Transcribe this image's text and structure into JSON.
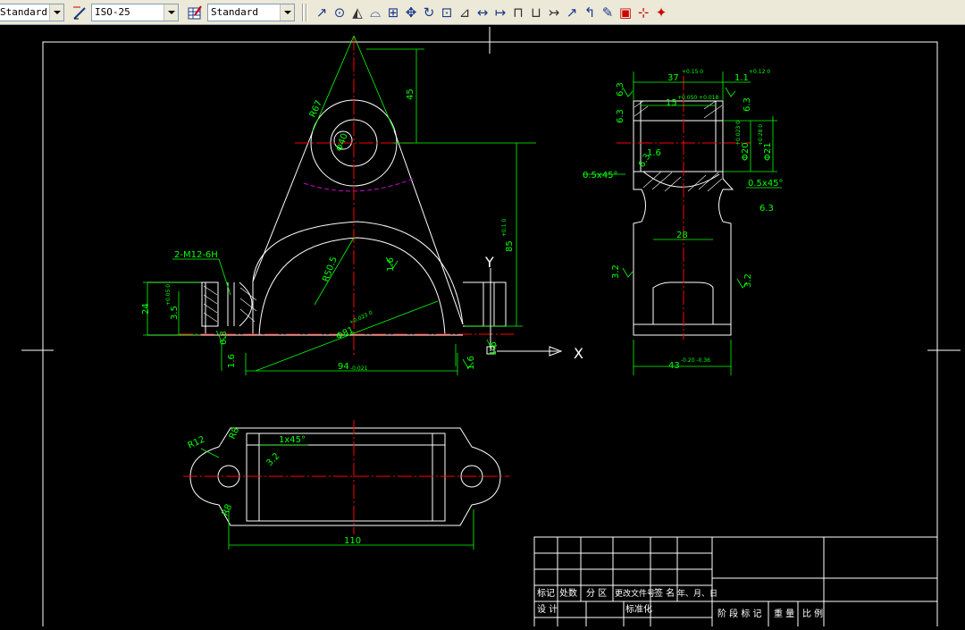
{
  "toolbar": {
    "text_style_value": "Standard",
    "dim_style_value": "ISO-25",
    "table_style_value": "Standard",
    "icons": [
      "dim-linear-icon",
      "dim-aligned-icon",
      "dim-arc-icon",
      "dim-ordinate-icon",
      "dim-radius-icon",
      "dim-jogged-icon",
      "dim-diameter-icon",
      "dim-angular-icon",
      "quick-dim-icon",
      "dim-baseline-icon",
      "dim-continue-icon",
      "dim-space-icon",
      "dim-break-icon",
      "tolerance-icon",
      "center-mark-icon",
      "inspection-icon",
      "jogged-linear-icon",
      "dim-edit-icon",
      "dim-text-edit-icon",
      "dim-update-icon"
    ]
  },
  "drawing": {
    "ucs_y": "Y",
    "ucs_x": "X",
    "dims": {
      "r67": "R67",
      "d40": "Φ40",
      "d45": "45",
      "d85": "85",
      "d85_tol": "+0.1  0",
      "r50": "R50.5",
      "d81": "Φ81",
      "d81_tol": "+0.023  0",
      "thread": "2-M12-6H",
      "d24": "24",
      "d35": "3.5",
      "d35_tol": "+0.05  0",
      "d94": "94",
      "d94_tol": "-0.021",
      "r16a": "1.6",
      "r63a": "6.3",
      "r16b": "1.6",
      "r16c": "1.6",
      "r16d": "1.6",
      "r16e": "1.6",
      "d37": "37",
      "d37_tol": "+0.15  0",
      "d11": "1.1",
      "d11_tol": "+0.12  0",
      "d15": "15",
      "d15_tol": "+0.050  +0.018",
      "d20": "Φ20",
      "d20_tol": "+0.023  0",
      "d21": "Φ21",
      "d21_tol": "+0.28  0",
      "r63b": "6.3",
      "r63c": "6.3",
      "r63d": "6.3",
      "r16f": "1.6",
      "r63e": "6.3",
      "ch1": "0.5x45°",
      "ch2": "0.5x45°",
      "r63f": "6.3",
      "d28": "28",
      "r32a": "3.2",
      "r32b": "3.2",
      "d43": "43",
      "d43_tol": "-0.20  -0.36",
      "r12": "R12",
      "r8a": "R8",
      "r8b": "R8",
      "ch3": "1x45°",
      "r32c": "3.2",
      "d110": "110"
    },
    "title_block": {
      "biaoji": "标记",
      "chushu": "处数",
      "fenqu": "分 区",
      "genggai": "更改文件号",
      "qianming": "签 名",
      "riqi": "年、月、日",
      "sheji": "设 计",
      "biaozhunhua": "标准化",
      "jieduan": "阶 段 标 记",
      "zhongliang": "重 量",
      "bili": "比 例"
    }
  }
}
